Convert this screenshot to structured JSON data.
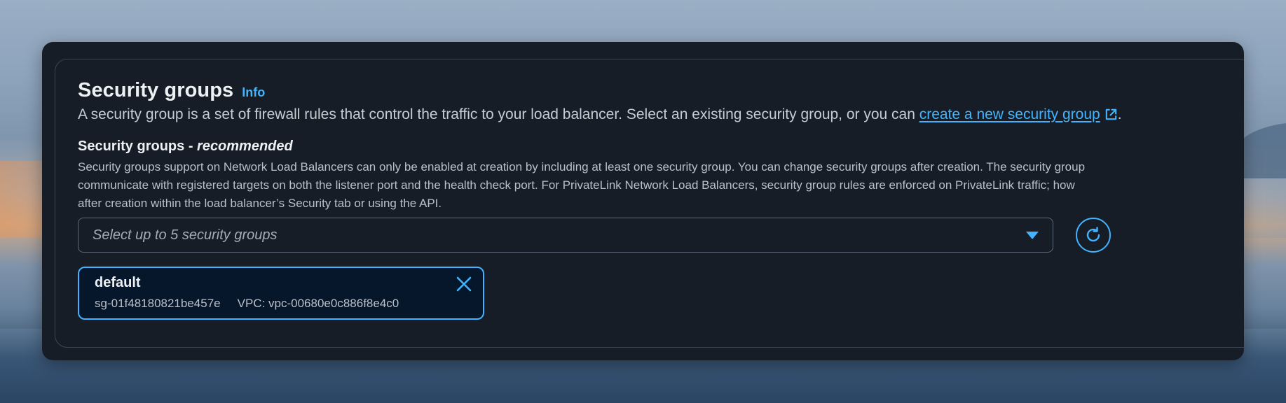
{
  "security_groups": {
    "title": "Security groups",
    "info_label": "Info",
    "description_prefix": "A security group is a set of firewall rules that control the traffic to your load balancer. Select an existing security group, or you can ",
    "create_link_label": "create a new security group",
    "description_suffix": ".",
    "field": {
      "label": "Security groups - ",
      "label_emphasis": "recommended",
      "description_lines": [
        "Security groups support on Network Load Balancers can only be enabled at creation by including at least one security group. You can change security groups after creation. The security group",
        "communicate with registered targets on both the listener port and the health check port. For PrivateLink Network Load Balancers, security group rules are enforced on PrivateLink traffic; how",
        "after creation within the load balancer’s Security tab or using the API."
      ],
      "select_placeholder": "Select up to 5 security groups"
    },
    "selected": [
      {
        "name": "default",
        "id": "sg-01f48180821be457e",
        "vpc": "VPC: vpc-00680e0c886f8e4c0"
      }
    ]
  },
  "icons": {
    "external_link": "external-link-icon",
    "caret": "caret-down-icon",
    "refresh": "refresh-icon",
    "remove": "close-icon"
  },
  "colors": {
    "accent": "#42b4ff",
    "panel_bg": "#161d26",
    "token_bg": "#06162b",
    "text_primary": "#eef1f4",
    "text_secondary": "#c6ccd4"
  }
}
